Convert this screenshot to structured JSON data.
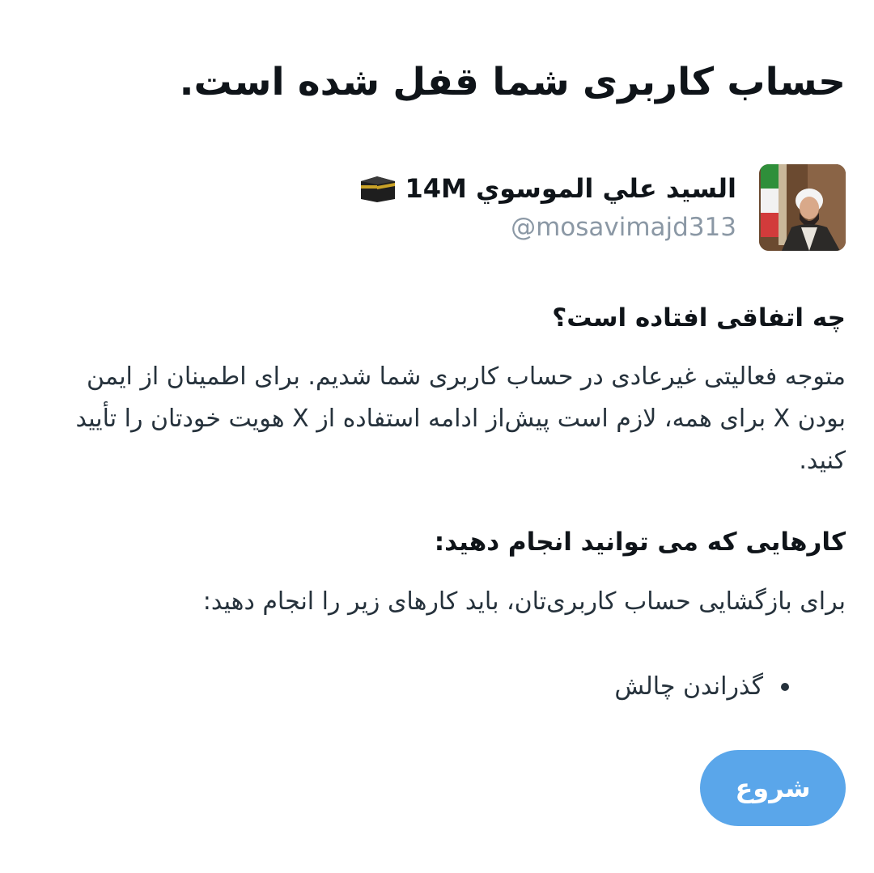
{
  "header": {
    "title": "حساب کاربری شما قفل شده است."
  },
  "account": {
    "display_name": "السيد علي الموسوي 14M",
    "name_emoji_icon": "kaaba-icon",
    "handle": "@mosavimajd313"
  },
  "what_happened": {
    "heading": "چه اتفاقی افتاده است؟",
    "body": "متوجه فعالیتی غیرعادی در حساب کاربری شما شدیم. برای اطمینان از ایمن بودن X برای همه، لازم است پیش‌از ادامه استفاده از X هویت خودتان را تأیید کنید."
  },
  "what_you_can_do": {
    "heading": "کارهایی که می توانید انجام دهید:",
    "body": "برای بازگشایی حساب کاربری‌تان، باید کارهای زیر را انجام دهید:",
    "steps": [
      "گذراندن چالش"
    ]
  },
  "actions": {
    "start_label": "شروع",
    "start_color": "#5aa6ea"
  }
}
